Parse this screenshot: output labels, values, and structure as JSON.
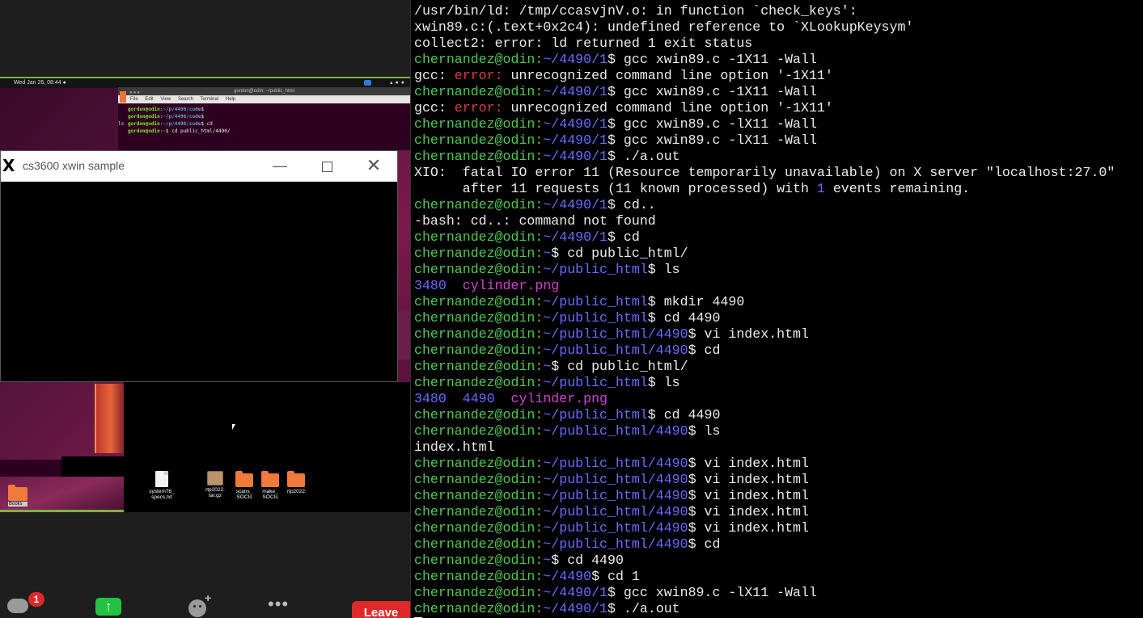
{
  "share": {
    "topbar_date": "Wed Jan 26, 08:44 ●",
    "mini_terminal": {
      "title": "gordon@odin: ~/public_html",
      "menu": [
        "File",
        "Edit",
        "View",
        "Search",
        "Terminal",
        "Help"
      ],
      "lines": [
        {
          "user": "gordon@odin",
          "path": ":~/p/4490/code",
          "cmd": "$ "
        },
        {
          "user": "gordon@odin",
          "path": ":~/p/4490/code",
          "cmd": "$ "
        },
        {
          "user": "gordon@odin",
          "path": ":~/p/4490/code",
          "cmd": "$ cd"
        },
        {
          "user": "gordon@odin",
          "path": ":~",
          "cmd": "$ cd public_html/4490/"
        }
      ],
      "ls_fragment": "ls "
    },
    "xwin": {
      "title": "cs3600 xwin sample",
      "minimize": "—",
      "close": "✕"
    },
    "desktop_icons": [
      {
        "label": "system76_\nspecs.txt",
        "type": "file"
      },
      {
        "label": "rtp2022.\ntar.gz",
        "type": "archive"
      },
      {
        "label": "scans_\nSOCIs",
        "type": "folder"
      },
      {
        "label": "make_\nSOCIs",
        "type": "folder"
      },
      {
        "label": "rtp2022",
        "type": "folder"
      }
    ],
    "left_folder_label": "Books"
  },
  "toolbar": {
    "chat_badge": "1",
    "share_icon": "↑",
    "more_icon": "•••",
    "leave_label": "Leave"
  },
  "terminal": {
    "prompt_user": "chernandez@odin",
    "lines": [
      {
        "t": "plain",
        "text": "/usr/bin/ld: /tmp/ccasvjnV.o: in function `check_keys':"
      },
      {
        "t": "plain",
        "text": "xwin89.c:(.text+0x2c4): undefined reference to `XLookupKeysym'"
      },
      {
        "t": "plain",
        "text": "collect2: error: ld returned 1 exit status"
      },
      {
        "t": "prompt",
        "path": "~/4490/1",
        "cmd": "gcc xwin89.c -1X11 -Wall"
      },
      {
        "t": "gccerr",
        "err": "error:",
        "text": " unrecognized command line option '-1X11'"
      },
      {
        "t": "prompt",
        "path": "~/4490/1",
        "cmd": "gcc xwin89.c -1X11 -Wall"
      },
      {
        "t": "gccerr",
        "err": "error:",
        "text": " unrecognized command line option '-1X11'"
      },
      {
        "t": "prompt",
        "path": "~/4490/1",
        "cmd": "gcc xwin89.c -lX11 -Wall"
      },
      {
        "t": "prompt",
        "path": "~/4490/1",
        "cmd": "gcc xwin89.c -lX11 -Wall"
      },
      {
        "t": "prompt",
        "path": "~/4490/1",
        "cmd": "./a.out"
      },
      {
        "t": "plain",
        "text": "XIO:  fatal IO error 11 (Resource temporarily unavailable) on X server \"localhost:27.0\""
      },
      {
        "t": "xio2",
        "pre": "      after 11 requests (11 known processed) with ",
        "num": "1",
        "post": " events remaining."
      },
      {
        "t": "prompt",
        "path": "~/4490/1",
        "cmd": "cd.."
      },
      {
        "t": "plain",
        "text": "-bash: cd..: command not found"
      },
      {
        "t": "prompt",
        "path": "~/4490/1",
        "cmd": "cd"
      },
      {
        "t": "prompt",
        "path": "~",
        "cmd": "cd public_html/"
      },
      {
        "t": "prompt",
        "path": "~/public_html",
        "cmd": "ls"
      },
      {
        "t": "ls",
        "items": [
          {
            "text": "3480",
            "k": "dir"
          },
          {
            "text": "cylinder.png",
            "k": "png"
          }
        ]
      },
      {
        "t": "prompt",
        "path": "~/public_html",
        "cmd": "mkdir 4490"
      },
      {
        "t": "prompt",
        "path": "~/public_html",
        "cmd": "cd 4490"
      },
      {
        "t": "prompt",
        "path": "~/public_html/4490",
        "cmd": "vi index.html"
      },
      {
        "t": "prompt",
        "path": "~/public_html/4490",
        "cmd": "cd"
      },
      {
        "t": "prompt",
        "path": "~",
        "cmd": "cd public_html/"
      },
      {
        "t": "prompt",
        "path": "~/public_html",
        "cmd": "ls"
      },
      {
        "t": "ls",
        "items": [
          {
            "text": "3480",
            "k": "dir"
          },
          {
            "text": "4490",
            "k": "dir"
          },
          {
            "text": "cylinder.png",
            "k": "png"
          }
        ]
      },
      {
        "t": "prompt",
        "path": "~/public_html",
        "cmd": "cd 4490"
      },
      {
        "t": "prompt",
        "path": "~/public_html/4490",
        "cmd": "ls"
      },
      {
        "t": "plain",
        "text": "index.html"
      },
      {
        "t": "prompt",
        "path": "~/public_html/4490",
        "cmd": "vi index.html"
      },
      {
        "t": "prompt",
        "path": "~/public_html/4490",
        "cmd": "vi index.html"
      },
      {
        "t": "prompt",
        "path": "~/public_html/4490",
        "cmd": "vi index.html"
      },
      {
        "t": "prompt",
        "path": "~/public_html/4490",
        "cmd": "vi index.html"
      },
      {
        "t": "prompt",
        "path": "~/public_html/4490",
        "cmd": "vi index.html"
      },
      {
        "t": "prompt",
        "path": "~/public_html/4490",
        "cmd": "cd"
      },
      {
        "t": "prompt",
        "path": "~",
        "cmd": "cd 4490"
      },
      {
        "t": "prompt",
        "path": "~/4490",
        "cmd": "cd 1"
      },
      {
        "t": "prompt",
        "path": "~/4490/1",
        "cmd": "gcc xwin89.c -lX11 -Wall"
      },
      {
        "t": "prompt",
        "path": "~/4490/1",
        "cmd": "./a.out"
      }
    ]
  },
  "colors": {
    "prompt_user": "#4ec94e",
    "prompt_path": "#6a6aff",
    "error": "#e03c3c",
    "png_file": "#d43fd4",
    "leave_button": "#e02828",
    "share_button": "#23c244"
  }
}
